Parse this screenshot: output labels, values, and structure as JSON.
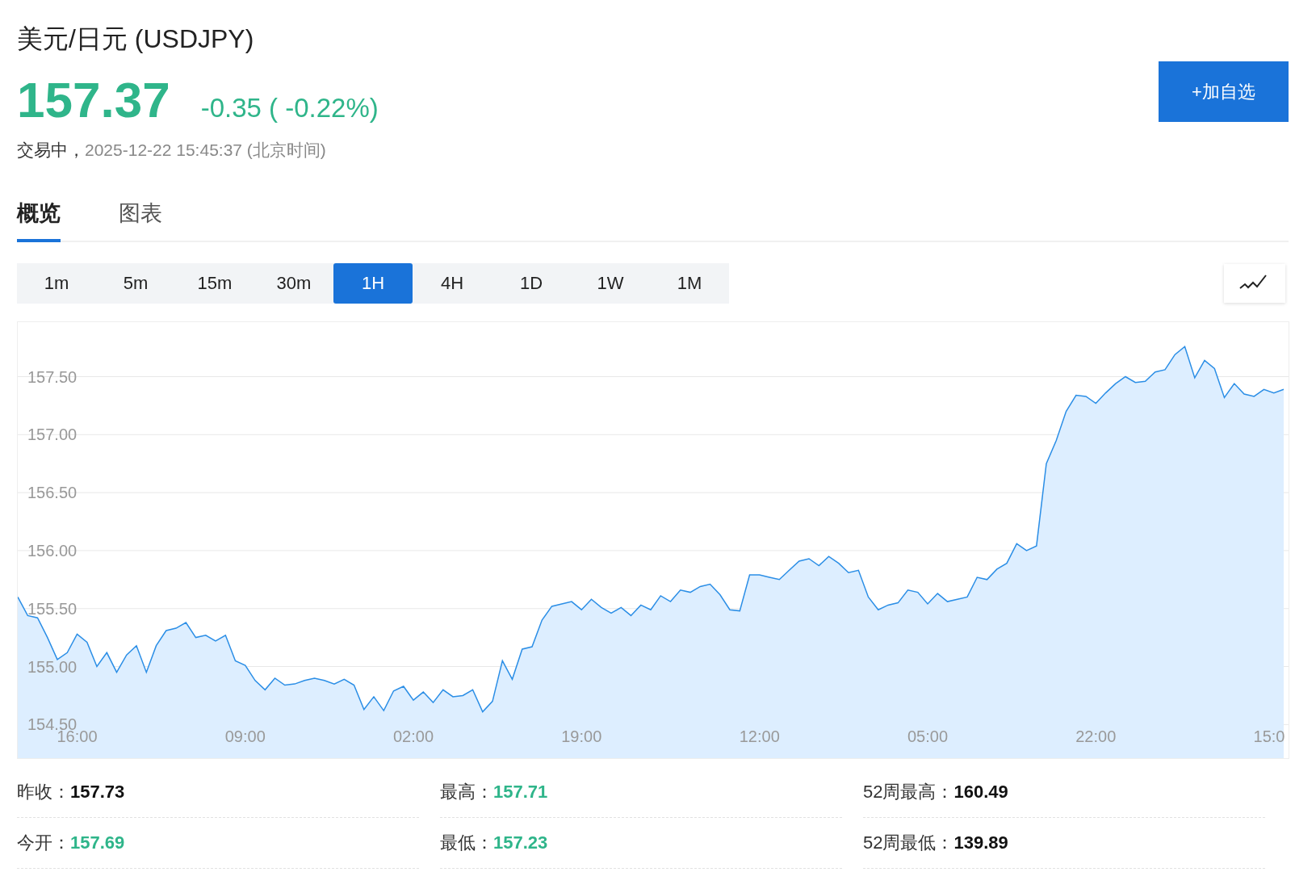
{
  "header": {
    "title": "美元/日元 (USDJPY)",
    "price": "157.37",
    "change": "-0.35 ( -0.22%)",
    "status": "交易中，",
    "time": "2025-12-22 15:45:37 (北京时间)",
    "watch_button": "+加自选"
  },
  "tabs": [
    {
      "label": "概览",
      "selected": true
    },
    {
      "label": "图表",
      "selected": false
    }
  ],
  "intervals": [
    {
      "label": "1m",
      "selected": false
    },
    {
      "label": "5m",
      "selected": false
    },
    {
      "label": "15m",
      "selected": false
    },
    {
      "label": "30m",
      "selected": false
    },
    {
      "label": "1H",
      "selected": true
    },
    {
      "label": "4H",
      "selected": false
    },
    {
      "label": "1D",
      "selected": false
    },
    {
      "label": "1W",
      "selected": false
    },
    {
      "label": "1M",
      "selected": false
    }
  ],
  "chart": {
    "chart_data": {
      "type": "area",
      "grid": true,
      "ylim": [
        154.21,
        157.97
      ],
      "categories": [
        null,
        null,
        null,
        null,
        null,
        null,
        "16:00",
        null,
        null,
        null,
        null,
        null,
        null,
        null,
        null,
        null,
        null,
        null,
        null,
        null,
        null,
        null,
        null,
        "09:00",
        null,
        null,
        null,
        null,
        null,
        null,
        null,
        null,
        null,
        null,
        null,
        null,
        null,
        null,
        null,
        null,
        "02:00",
        null,
        null,
        null,
        null,
        null,
        null,
        null,
        null,
        null,
        null,
        null,
        null,
        null,
        null,
        null,
        null,
        "19:00",
        null,
        null,
        null,
        null,
        null,
        null,
        null,
        null,
        null,
        null,
        null,
        null,
        null,
        null,
        null,
        null,
        null,
        "12:00",
        null,
        null,
        null,
        null,
        null,
        null,
        null,
        null,
        null,
        null,
        null,
        null,
        null,
        null,
        null,
        null,
        "05:00",
        null,
        null,
        null,
        null,
        null,
        null,
        null,
        null,
        null,
        null,
        null,
        null,
        null,
        null,
        null,
        null,
        "22:00",
        null,
        null,
        null,
        null,
        null,
        null,
        null,
        null,
        null,
        null,
        null,
        null,
        null,
        null,
        null,
        null,
        null,
        "15:0",
        null
      ],
      "yticks": [
        {
          "value": 154.5,
          "label": "154.50"
        },
        {
          "value": 155,
          "label": "155.00"
        },
        {
          "value": 155.5,
          "label": "155.50"
        },
        {
          "value": 156,
          "label": "156.00"
        },
        {
          "value": 156.5,
          "label": "156.50"
        },
        {
          "value": 157,
          "label": "157.00"
        },
        {
          "value": 157.5,
          "label": "157.50"
        }
      ],
      "series": [
        {
          "color": "#2b8ee6",
          "values": [
            155.6,
            155.44,
            155.42,
            155.25,
            155.06,
            155.12,
            155.28,
            155.21,
            155.0,
            155.12,
            154.95,
            155.1,
            155.18,
            154.95,
            155.18,
            155.31,
            155.33,
            155.38,
            155.25,
            155.27,
            155.22,
            155.27,
            155.05,
            155.01,
            154.88,
            154.8,
            154.9,
            154.84,
            154.85,
            154.88,
            154.9,
            154.88,
            154.85,
            154.89,
            154.84,
            154.63,
            154.74,
            154.62,
            154.79,
            154.83,
            154.71,
            154.78,
            154.69,
            154.8,
            154.74,
            154.75,
            154.8,
            154.61,
            154.7,
            155.05,
            154.89,
            155.15,
            155.17,
            155.4,
            155.52,
            155.54,
            155.56,
            155.49,
            155.58,
            155.51,
            155.46,
            155.51,
            155.44,
            155.53,
            155.49,
            155.61,
            155.56,
            155.66,
            155.64,
            155.69,
            155.71,
            155.62,
            155.49,
            155.48,
            155.79,
            155.79,
            155.77,
            155.75,
            155.83,
            155.91,
            155.93,
            155.87,
            155.95,
            155.89,
            155.81,
            155.83,
            155.6,
            155.49,
            155.53,
            155.55,
            155.66,
            155.64,
            155.54,
            155.63,
            155.56,
            155.58,
            155.6,
            155.77,
            155.75,
            155.84,
            155.89,
            156.06,
            156.0,
            156.04,
            156.75,
            156.95,
            157.2,
            157.34,
            157.33,
            157.27,
            157.36,
            157.44,
            157.5,
            157.45,
            157.46,
            157.54,
            157.56,
            157.69,
            157.76,
            157.49,
            157.64,
            157.57,
            157.32,
            157.44,
            157.35,
            157.33,
            157.39,
            157.36,
            157.39
          ]
        }
      ]
    }
  },
  "stats": [
    {
      "label": "昨收：",
      "value": "157.73",
      "color": "#111111"
    },
    {
      "label": "最高：",
      "value": "157.71",
      "color": "#2fb58a"
    },
    {
      "label": "52周最高：",
      "value": "160.49",
      "color": "#111111"
    },
    {
      "label": "今开：",
      "value": "157.69",
      "color": "#2fb58a"
    },
    {
      "label": "最低：",
      "value": "157.23",
      "color": "#2fb58a"
    },
    {
      "label": "52周最低：",
      "value": "139.89",
      "color": "#111111"
    }
  ]
}
